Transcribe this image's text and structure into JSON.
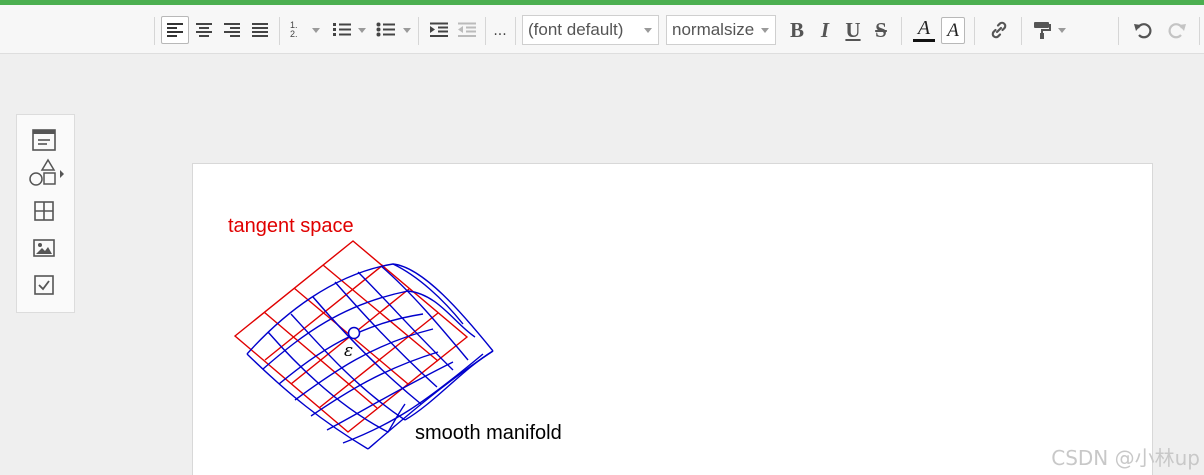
{
  "toolbar": {
    "font_family_value": "(font default)",
    "font_size_value": "normalsize",
    "bold_label": "B",
    "italic_label": "I",
    "underline_label": "U",
    "strike_label": "S",
    "text_color_label": "A",
    "highlight_label": "A",
    "more_label": "...",
    "ordered_list_label": "1.2.",
    "icons": [
      "align-left-icon",
      "align-center-icon",
      "align-right-icon",
      "align-justify-icon",
      "ordered-list-icon",
      "numbered-list-icon",
      "bullet-list-icon",
      "indent-icon",
      "outdent-icon",
      "link-icon",
      "format-painter-icon",
      "undo-icon",
      "redo-icon"
    ]
  },
  "sidebar": {
    "icons": [
      "card-icon",
      "shapes-icon",
      "table-icon",
      "image-icon",
      "checkbox-icon"
    ]
  },
  "figure": {
    "tangent_label": "tangent space",
    "manifold_label": "smooth manifold",
    "point_label": "ε",
    "tangent_color": "#e00000",
    "manifold_color": "#0000cc"
  },
  "watermark": "CSDN @小林up",
  "colors": {
    "accent": "#4caf50"
  }
}
